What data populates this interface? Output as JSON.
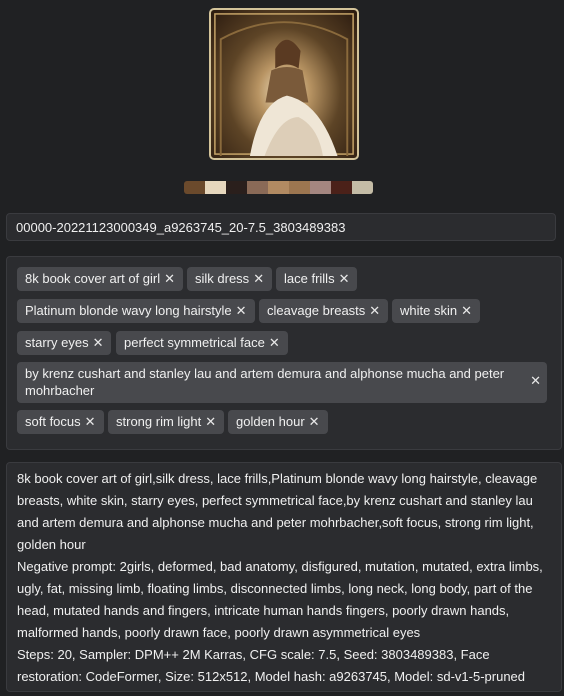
{
  "image": {
    "alt": "book cover art of girl in silk dress"
  },
  "palette": [
    "#6b4a2c",
    "#e6d7bd",
    "#2a1f1c",
    "#8a6a57",
    "#b18a62",
    "#9c7650",
    "#a48680",
    "#4b2119",
    "#c4bca6"
  ],
  "filename": "00000-20221123000349_a9263745_20-7.5_3803489383",
  "tags": [
    "8k book cover art of girl",
    "silk dress",
    "lace frills",
    "Platinum blonde wavy long hairstyle",
    "cleavage breasts",
    "white skin",
    "starry eyes",
    "perfect symmetrical face",
    "by krenz cushart and stanley lau and artem demura and alphonse mucha and peter mohrbacher",
    "soft focus",
    "strong rim light",
    "golden hour"
  ],
  "remove_glyph": "✕",
  "prompt_text": "8k book cover art of girl,silk dress, lace frills,Platinum blonde wavy long hairstyle, cleavage breasts, white skin, starry eyes, perfect symmetrical face,by krenz cushart and stanley lau and artem demura and alphonse mucha and peter mohrbacher,soft focus, strong rim light, golden hour",
  "negative_prompt": "Negative prompt: 2girls, deformed, bad anatomy, disfigured, mutation, mutated, extra limbs, ugly, fat, missing limb, floating limbs, disconnected limbs, long neck, long body, part of the head, mutated hands and fingers, intricate human hands fingers, poorly drawn hands, malformed hands, poorly drawn face, poorly drawn asymmetrical eyes",
  "params": "Steps: 20, Sampler: DPM++ 2M Karras, CFG scale: 7.5, Seed: 3803489383, Face restoration: CodeFormer, Size: 512x512, Model hash: a9263745, Model: sd-v1-5-pruned"
}
